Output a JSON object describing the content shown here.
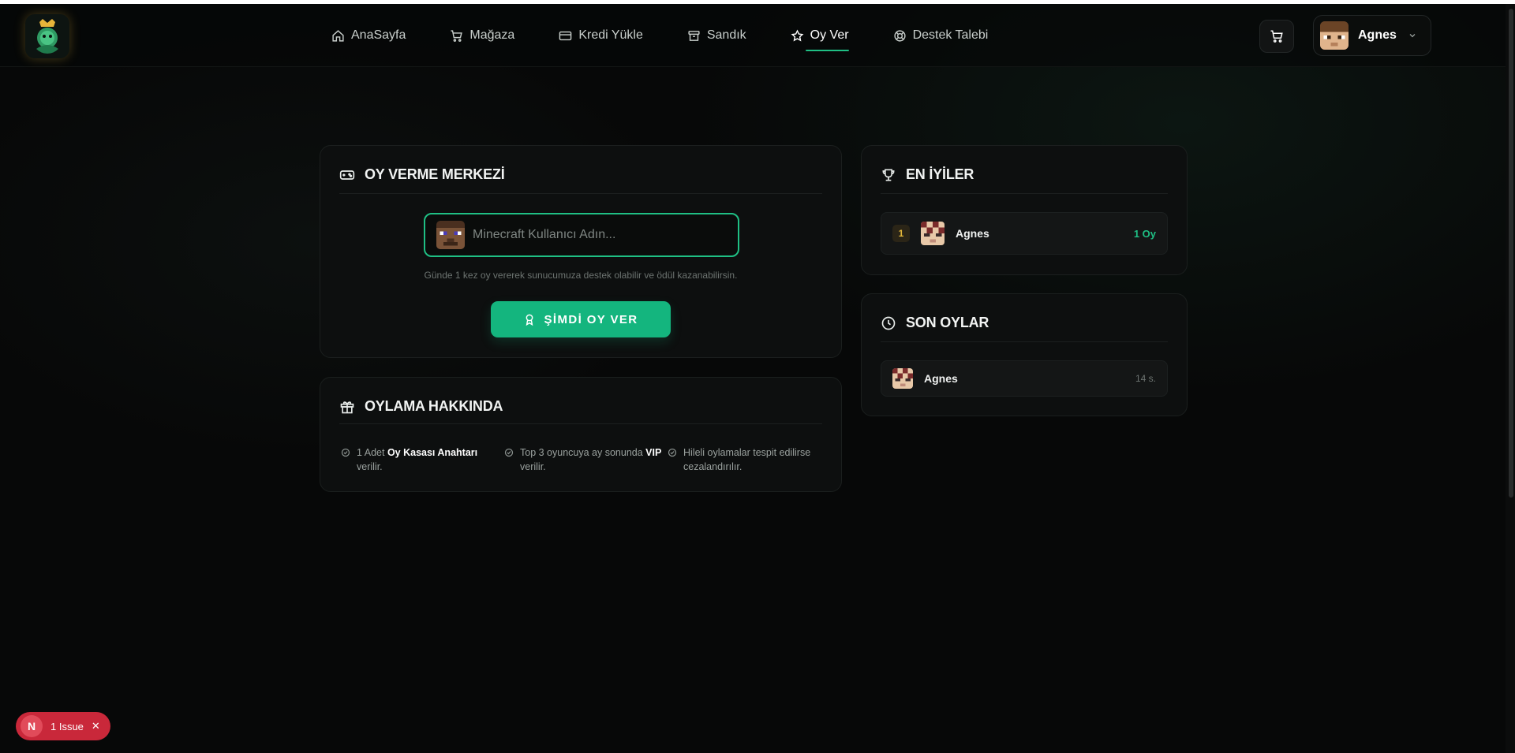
{
  "header": {
    "nav": [
      {
        "label": "AnaSayfa",
        "icon": "home-icon"
      },
      {
        "label": "Mağaza",
        "icon": "cart-icon"
      },
      {
        "label": "Kredi Yükle",
        "icon": "credit-card-icon"
      },
      {
        "label": "Sandık",
        "icon": "archive-box-icon"
      },
      {
        "label": "Oy Ver",
        "icon": "star-icon",
        "active": true
      },
      {
        "label": "Destek Talebi",
        "icon": "lifebuoy-icon"
      }
    ],
    "user": {
      "name": "Agnes"
    }
  },
  "vote_center": {
    "title": "OY VERME MERKEZİ",
    "input_placeholder": "Minecraft Kullanıcı Adın...",
    "hint": "Günde 1 kez oy vererek sunucumuza destek olabilir ve ödül kazanabilirsin.",
    "button_label": "ŞİMDİ OY VER"
  },
  "about": {
    "title": "OYLAMA HAKKINDA",
    "items": [
      {
        "pre": "1 Adet ",
        "bold": "Oy Kasası Anahtarı",
        "post": " verilir."
      },
      {
        "pre": "Top 3 oyuncuya ay sonunda ",
        "bold": "VIP",
        "post": " verilir."
      },
      {
        "pre": "Hileli oylamalar tespit edilirse cezalandırılır.",
        "bold": "",
        "post": ""
      }
    ]
  },
  "top_players": {
    "title": "EN İYİLER",
    "rows": [
      {
        "rank": "1",
        "name": "Agnes",
        "votes": "1 Oy"
      }
    ]
  },
  "recent_votes": {
    "title": "SON OYLAR",
    "rows": [
      {
        "name": "Agnes",
        "time": "14 s."
      }
    ]
  },
  "issue_badge": {
    "letter": "N",
    "label": "1 Issue",
    "close": "✕"
  },
  "colors": {
    "accent": "#1fbf84",
    "button": "#14b57e",
    "badge": "#c9283a",
    "rank_gold": "#e2b63a"
  }
}
